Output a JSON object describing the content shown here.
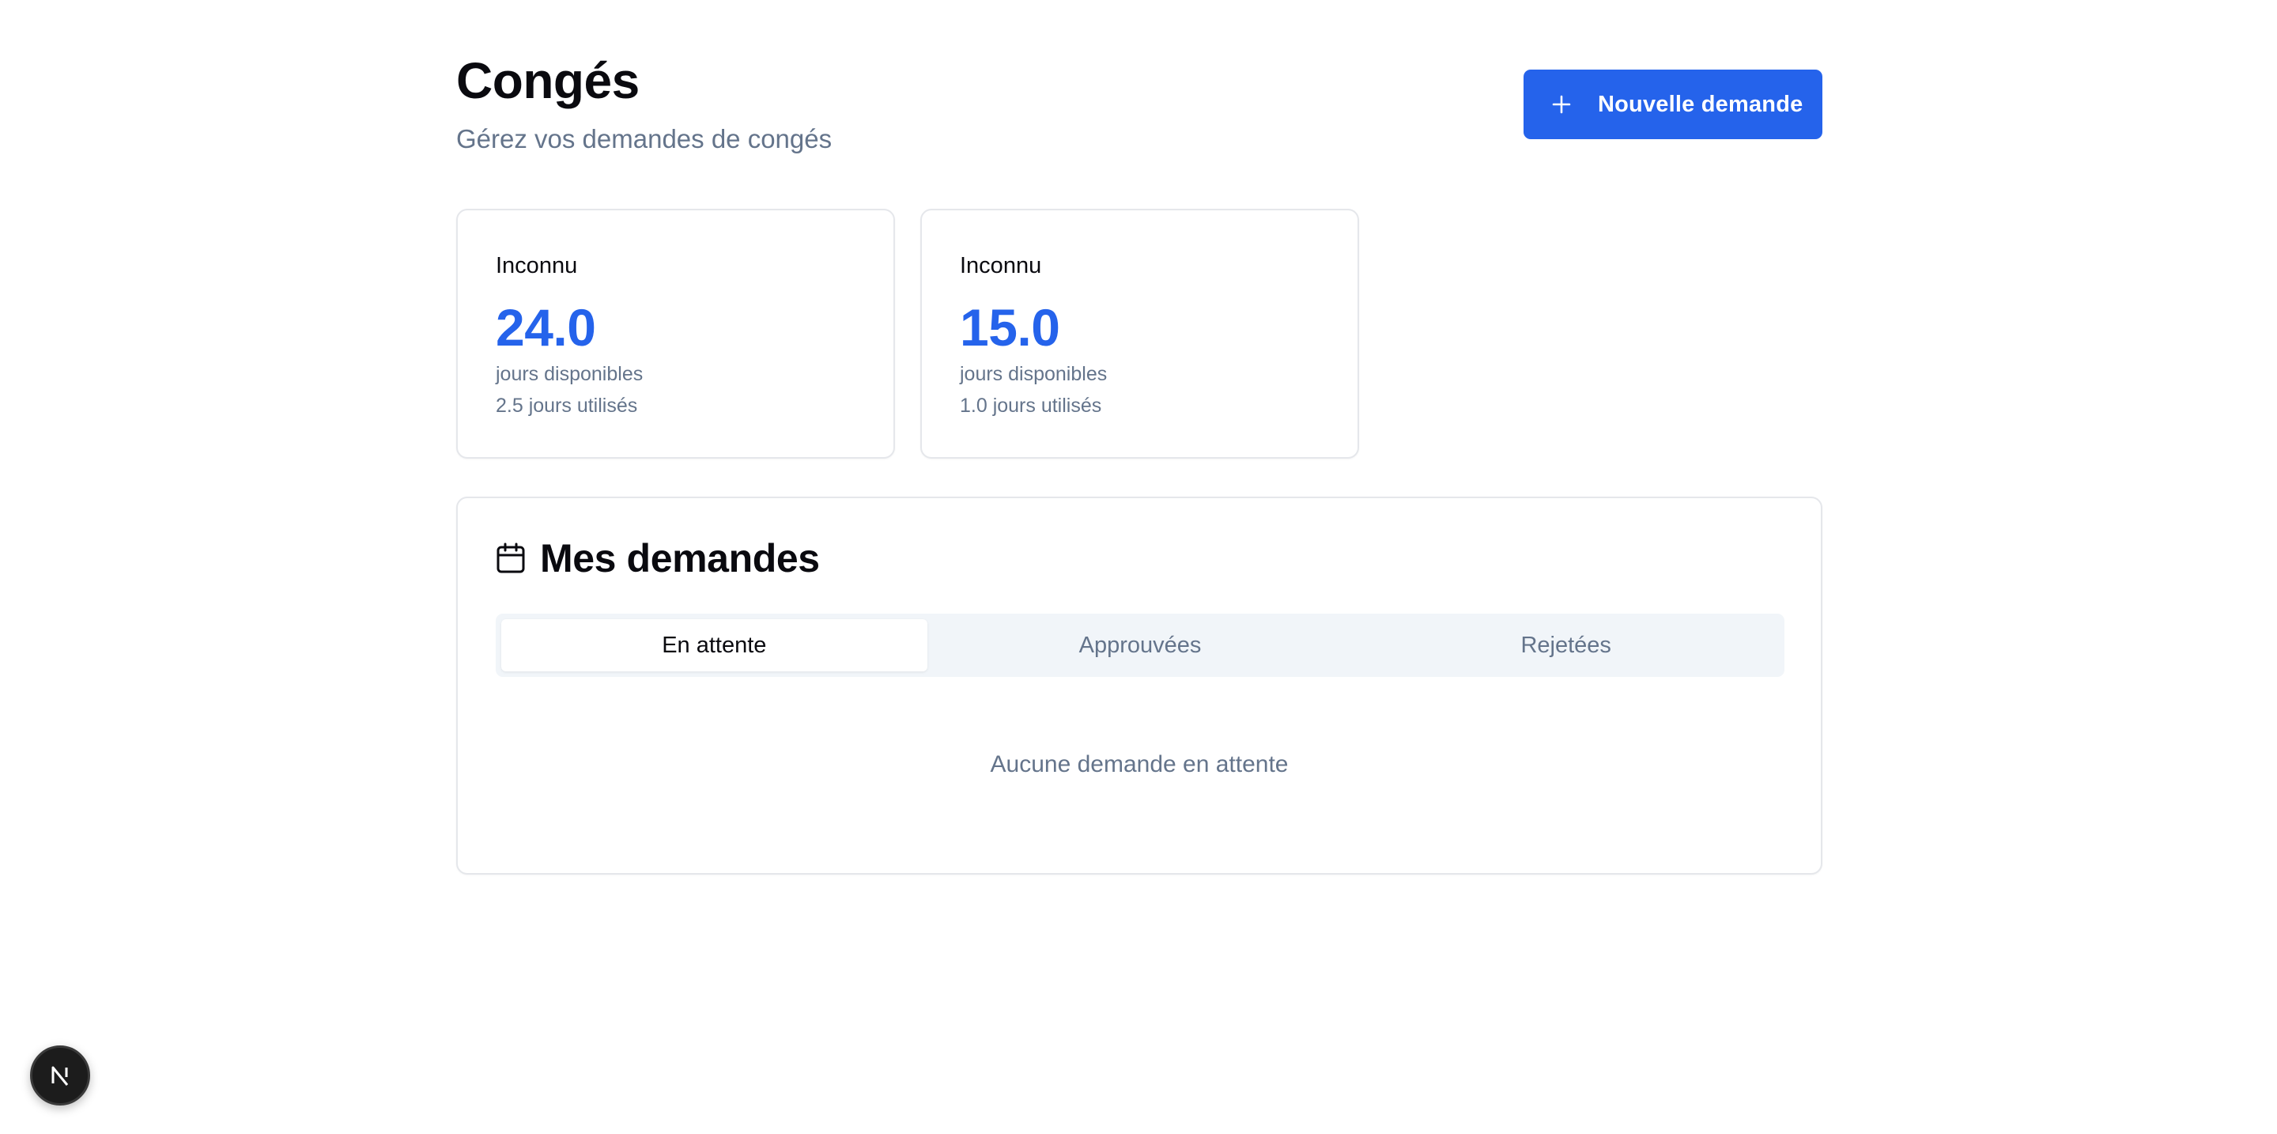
{
  "header": {
    "title": "Congés",
    "subtitle": "Gérez vos demandes de congés",
    "new_request_label": "Nouvelle demande"
  },
  "balances": [
    {
      "type": "Inconnu",
      "available": "24.0",
      "available_label": "jours disponibles",
      "used": "2.5 jours utilisés"
    },
    {
      "type": "Inconnu",
      "available": "15.0",
      "available_label": "jours disponibles",
      "used": "1.0 jours utilisés"
    }
  ],
  "requests": {
    "title": "Mes demandes",
    "tabs": [
      {
        "label": "En attente",
        "active": true
      },
      {
        "label": "Approuvées",
        "active": false
      },
      {
        "label": "Rejetées",
        "active": false
      }
    ],
    "empty_message": "Aucune demande en attente"
  },
  "icons": {
    "new_request": "plus-icon",
    "requests": "calendar-icon",
    "dev_badge": "nextjs-logo-icon"
  },
  "colors": {
    "accent": "#2563eb",
    "muted_text": "#64748b",
    "tab_background": "#f1f5f9",
    "border": "#e5e7eb"
  }
}
